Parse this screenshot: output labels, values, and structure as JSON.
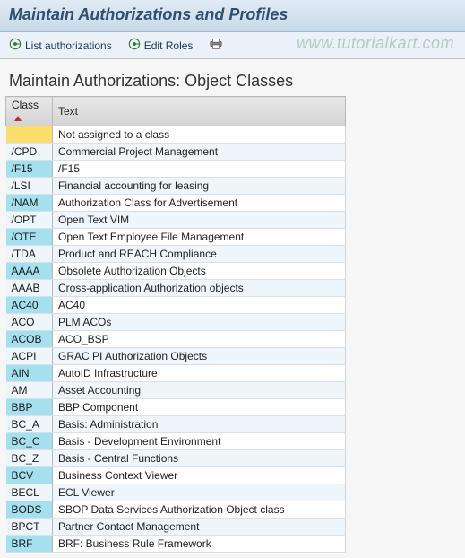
{
  "header": {
    "title": "Maintain Authorizations and Profiles"
  },
  "toolbar": {
    "list_auth_label": "List authorizations",
    "edit_roles_label": "Edit Roles"
  },
  "watermark": "www.tutorialkart.com",
  "subtitle": "Maintain Authorizations: Object Classes",
  "table": {
    "columns": {
      "class": "Class",
      "text": "Text"
    },
    "rows": [
      {
        "class": "",
        "text": "Not assigned to a class",
        "selected": true
      },
      {
        "class": "/CPD",
        "text": "Commercial Project Management"
      },
      {
        "class": "/F15",
        "text": "/F15"
      },
      {
        "class": "/LSI",
        "text": "Financial accounting for leasing"
      },
      {
        "class": "/NAM",
        "text": "Authorization Class for Advertisement"
      },
      {
        "class": "/OPT",
        "text": "Open Text VIM"
      },
      {
        "class": "/OTE",
        "text": "Open Text Employee File Management"
      },
      {
        "class": "/TDA",
        "text": "Product and REACH Compliance"
      },
      {
        "class": "AAAA",
        "text": "Obsolete Authorization Objects"
      },
      {
        "class": "AAAB",
        "text": "Cross-application Authorization objects"
      },
      {
        "class": "AC40",
        "text": "AC40"
      },
      {
        "class": "ACO",
        "text": "PLM ACOs"
      },
      {
        "class": "ACOB",
        "text": "ACO_BSP"
      },
      {
        "class": "ACPI",
        "text": "GRAC PI Authorization Objects"
      },
      {
        "class": "AIN",
        "text": "AutoID Infrastructure"
      },
      {
        "class": "AM",
        "text": "Asset Accounting"
      },
      {
        "class": "BBP",
        "text": "BBP Component"
      },
      {
        "class": "BC_A",
        "text": "Basis: Administration"
      },
      {
        "class": "BC_C",
        "text": "Basis - Development Environment"
      },
      {
        "class": "BC_Z",
        "text": "Basis - Central Functions"
      },
      {
        "class": "BCV",
        "text": "Business Context Viewer"
      },
      {
        "class": "BECL",
        "text": "ECL Viewer"
      },
      {
        "class": "BODS",
        "text": "SBOP Data Services Authorization Object class"
      },
      {
        "class": "BPCT",
        "text": "Partner Contact Management"
      },
      {
        "class": "BRF",
        "text": "BRF: Business Rule Framework"
      }
    ]
  }
}
